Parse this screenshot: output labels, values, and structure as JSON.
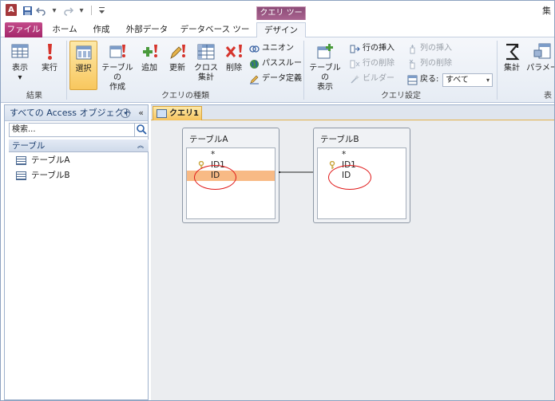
{
  "title_bar": {
    "app_icon": "A",
    "window_title": "集",
    "contextual_header": "クエリ ツール"
  },
  "tabs": [
    {
      "label": "ファイル"
    },
    {
      "label": "ホーム"
    },
    {
      "label": "作成"
    },
    {
      "label": "外部データ"
    },
    {
      "label": "データベース ツール"
    },
    {
      "label": "デザイン"
    }
  ],
  "ribbon": {
    "results_group": {
      "label": "結果",
      "view": "表示",
      "run": "実行"
    },
    "query_type_group": {
      "label": "クエリの種類",
      "select": "選択",
      "make_table_line1": "テーブルの",
      "make_table_line2": "作成",
      "append": "追加",
      "update": "更新",
      "crosstab_line1": "クロス",
      "crosstab_line2": "集計",
      "delete": "削除",
      "union": "ユニオン",
      "passthrough": "パススルー",
      "data_definition": "データ定義"
    },
    "query_setup_group": {
      "label": "クエリ設定",
      "show_table_line1": "テーブルの",
      "show_table_line2": "表示",
      "insert_row": "行の挿入",
      "delete_row": "行の削除",
      "builder": "ビルダー",
      "insert_column": "列の挿入",
      "delete_column": "列の削除",
      "return_label": "戻る:",
      "return_value": "すべて"
    },
    "show_hide_group": {
      "totals": "集計",
      "parameters": "パラメー",
      "label_partial": "表"
    }
  },
  "nav_pane": {
    "header": "すべての Access オブジェクト",
    "search_placeholder": "検索...",
    "group_label": "テーブル",
    "items": [
      {
        "label": "テーブルA"
      },
      {
        "label": "テーブルB"
      }
    ]
  },
  "document": {
    "tab_label": "クエリ1",
    "tables": [
      {
        "name": "テーブルA",
        "fields": [
          "*",
          "ID1",
          "ID"
        ],
        "key_field": "ID1",
        "selected_field": "ID"
      },
      {
        "name": "テーブルB",
        "fields": [
          "*",
          "ID1",
          "ID"
        ],
        "key_field": "ID1"
      }
    ]
  },
  "colors": {
    "file_tab": "#a4266a",
    "selection_highlight": "#f8ba85",
    "annotation": "#e01a1a"
  }
}
